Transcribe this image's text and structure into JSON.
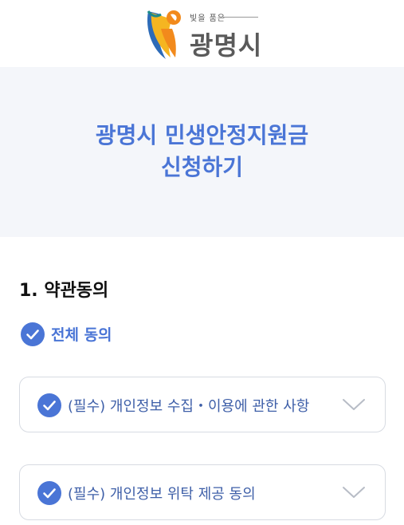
{
  "logo": {
    "slogan": "빛을 품은",
    "name": "광명시"
  },
  "hero": {
    "title_line1": "광명시 민생안정지원금",
    "title_line2": "신청하기"
  },
  "terms": {
    "section_title": "1. 약관동의",
    "agree_all_label": "전체 동의",
    "items": [
      {
        "label": "(필수) 개인정보 수집・이용에 관한 사항"
      },
      {
        "label": "(필수) 개인정보 위탁 제공 동의"
      }
    ]
  },
  "colors": {
    "accent": "#4a75d6",
    "hero_bg": "#f4f6fa",
    "card_border": "#d7dbe2"
  },
  "icons": {
    "check": "check-circle-icon",
    "chevron": "chevron-down-icon",
    "logo": "gwangmyeong-logo-mark"
  }
}
